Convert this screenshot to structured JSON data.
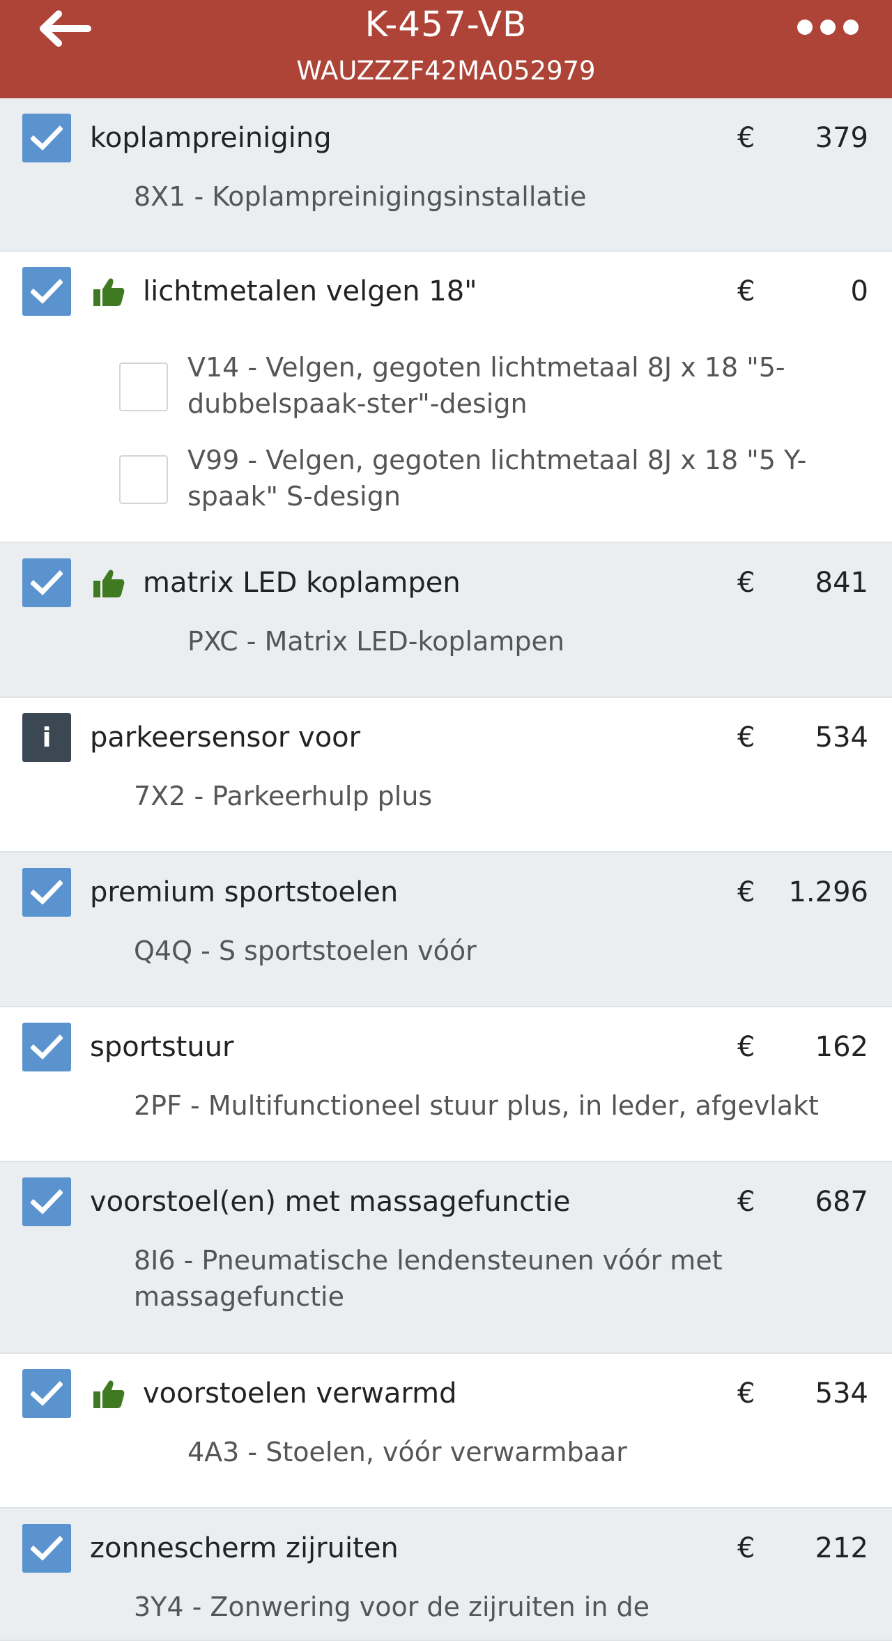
{
  "header": {
    "title": "K-457-VB",
    "subtitle": "WAUZZZF42MA052979",
    "back_icon": "arrow-left-icon",
    "more_icon": "more-horizontal-icon",
    "background": "#ad4437"
  },
  "currency": "€",
  "options": [
    {
      "title": "koplampreiniging",
      "price": "379",
      "checked": true,
      "desc": "8X1 - Koplampreinigingsinstallatie"
    },
    {
      "title": "lichtmetalen velgen 18\"",
      "price": "0",
      "checked": true,
      "recommended": true,
      "sub": [
        {
          "label": "V14 - Velgen, gegoten lichtmetaal 8J x 18 \"5-\ndubbelspaak-ster\"-design",
          "checked": false
        },
        {
          "label": "V99 - Velgen, gegoten lichtmetaal 8J x 18 \"5 Y-\nspaak\" S-design",
          "checked": false
        }
      ]
    },
    {
      "title": "matrix LED koplampen",
      "price": "841",
      "checked": true,
      "recommended": true,
      "desc": "PXC - Matrix LED-koplampen"
    },
    {
      "title": "parkeersensor voor",
      "price": "534",
      "info": true,
      "info_label": "i",
      "desc": "7X2 - Parkeerhulp plus"
    },
    {
      "title": "premium sportstoelen",
      "price": "1.296",
      "checked": true,
      "desc": "Q4Q - S sportstoelen vóór"
    },
    {
      "title": "sportstuur",
      "price": "162",
      "checked": true,
      "desc": "2PF - Multifunctioneel stuur plus, in leder, afgevlakt"
    },
    {
      "title": "voorstoel(en) met massagefunctie",
      "price": "687",
      "checked": true,
      "desc": "8I6 - Pneumatische lendensteunen vóór met\nmassagefunctie"
    },
    {
      "title": "voorstoelen verwarmd",
      "price": "534",
      "checked": true,
      "recommended": true,
      "desc": "4A3 - Stoelen, vóór verwarmbaar"
    },
    {
      "title": "zonnescherm zijruiten",
      "price": "212",
      "checked": true,
      "desc": "3Y4 - Zonwering voor de zijruiten in de"
    }
  ]
}
